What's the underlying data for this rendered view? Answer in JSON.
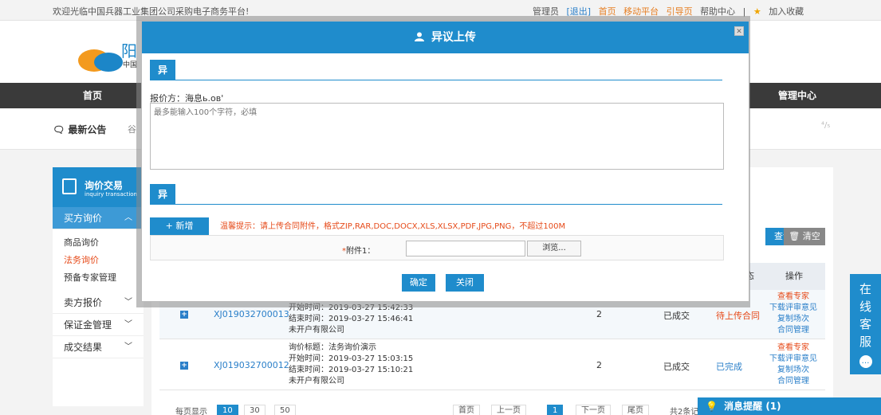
{
  "topbar": {
    "welcome": "欢迎光临中国兵器工业集团公司采购电子商务平台!",
    "admin": "管理员",
    "logout": "[退出]",
    "home": "首页",
    "mobile": "移动平台",
    "guide": "引导页",
    "help": "帮助中心",
    "favorite": "加入收藏",
    "star": "★"
  },
  "logo": {
    "text": "阳",
    "sub": "中国"
  },
  "nav": {
    "home": "首页",
    "manage": "管理中心"
  },
  "notice": {
    "title": "最新公告",
    "extra": "谷",
    "pager": "⁴/₅"
  },
  "sidebar": {
    "title": "询价交易",
    "title_en": "inquiry transaction",
    "sections": [
      {
        "label": "买方询价",
        "chev": "︿"
      },
      {
        "label": "卖方报价",
        "chev": "﹀"
      },
      {
        "label": "保证金管理",
        "chev": "﹀"
      },
      {
        "label": "成交结果",
        "chev": "﹀"
      }
    ],
    "subs": [
      "商品询价",
      "法务询价",
      "预备专家管理"
    ]
  },
  "main": {
    "query_btn": "查询",
    "clear_btn": "清空",
    "col_state": "态",
    "col_ops": "操作"
  },
  "rows": [
    {
      "code": "XJ019032700013",
      "lines": [
        "开始时间：2019-03-27 15:42:33",
        "结束时间：2019-03-27 15:46:41",
        "未开户有限公司"
      ],
      "count": "2",
      "state": "已成交",
      "state2": "待上传合同",
      "ops": [
        "查看专家",
        "下载评审意见",
        "复制场次",
        "合同管理"
      ]
    },
    {
      "code": "XJ019032700012",
      "lines": [
        "询价标题：法务询价演示",
        "开始时间：2019-03-27 15:03:15",
        "结束时间：2019-03-27 15:10:21",
        "未开户有限公司"
      ],
      "count": "2",
      "state": "已成交",
      "state2": "已完成",
      "ops": [
        "查看专家",
        "下载评审意见",
        "复制场次",
        "合同管理"
      ]
    }
  ],
  "pager": {
    "per_page": "每页显示",
    "sizes": [
      "10",
      "30",
      "50"
    ],
    "first": "首页",
    "prev": "上一页",
    "cur": "1",
    "next": "下一页",
    "last": "尾页",
    "total": "共2条记"
  },
  "service": {
    "chars": [
      "在",
      "线",
      "客",
      "服"
    ],
    "dot": "…"
  },
  "msgbar": {
    "label": "消息提醒 (1)",
    "bulb": "💡"
  },
  "modal": {
    "title": "异议上传",
    "close": "✕",
    "section1": "异议说明",
    "quote_label": "报价方：海息ь.ов'",
    "textarea_placeholder": "最多能输入100个字符，必填",
    "section2": "异议附件",
    "add_btn": "+ 新增",
    "tip": "温馨提示：请上传合同附件，格式ZIP,RAR,DOC,DOCX,XLS,XLSX,PDF,JPG,PNG，不超过100M",
    "attach_req": "*",
    "attach_label": "附件1：",
    "browse": "浏览...",
    "ok": "确定",
    "close_btn": "关闭"
  }
}
